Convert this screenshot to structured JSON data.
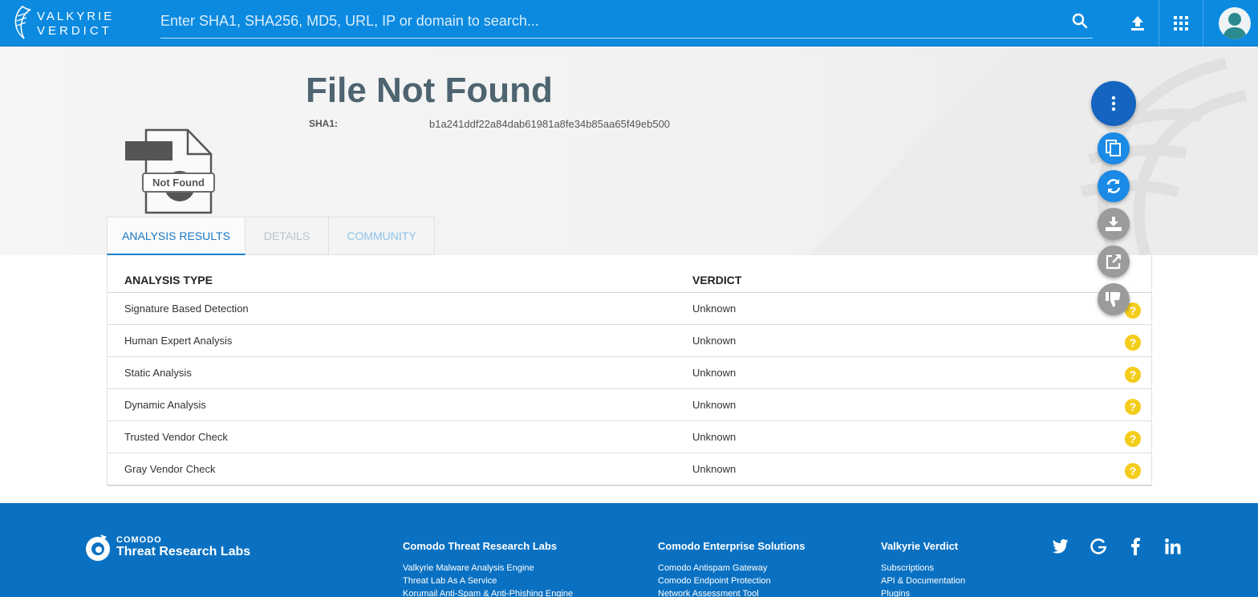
{
  "header": {
    "logo_line1": "VALKYRIE",
    "logo_line2": "VERDICT",
    "search_placeholder": "Enter SHA1, SHA256, MD5, URL, IP or domain to search..."
  },
  "file": {
    "title": "File Not Found",
    "status_badge": "Not Found",
    "sha1_label": "SHA1:",
    "sha1_value": "b1a241ddf22a84dab61981a8fe34b85aa65f49eb500"
  },
  "tabs": [
    {
      "label": "ANALYSIS RESULTS",
      "active": true
    },
    {
      "label": "DETAILS",
      "active": false
    },
    {
      "label": "COMMUNITY",
      "active": false
    }
  ],
  "table": {
    "headers": [
      "ANALYSIS TYPE",
      "VERDICT"
    ],
    "rows": [
      {
        "type": "Signature Based Detection",
        "verdict": "Unknown",
        "icon": "?"
      },
      {
        "type": "Human Expert Analysis",
        "verdict": "Unknown",
        "icon": "?"
      },
      {
        "type": "Static Analysis",
        "verdict": "Unknown",
        "icon": "?"
      },
      {
        "type": "Dynamic Analysis",
        "verdict": "Unknown",
        "icon": "?"
      },
      {
        "type": "Trusted Vendor Check",
        "verdict": "Unknown",
        "icon": "?"
      },
      {
        "type": "Gray Vendor Check",
        "verdict": "Unknown",
        "icon": "?"
      }
    ]
  },
  "fab_icons": [
    "more-vert-icon",
    "copy-icon",
    "refresh-icon",
    "download-icon",
    "external-link-icon",
    "thumbs-down-icon"
  ],
  "footer": {
    "logo_line1": "COMODO",
    "logo_line2": "Threat Research Labs",
    "columns": [
      {
        "title": "Comodo Threat Research Labs",
        "links": [
          "Valkyrie Malware Analysis Engine",
          "Threat Lab As A Service",
          "Korumail Anti-Spam & Anti-Phishing Engine"
        ]
      },
      {
        "title": "Comodo Enterprise Solutions",
        "links": [
          "Comodo Antispam Gateway",
          "Comodo Endpoint Protection",
          "Network Assessment Tool"
        ]
      },
      {
        "title": "Valkyrie Verdict",
        "links": [
          "Subscriptions",
          "API & Documentation",
          "Plugins"
        ]
      }
    ],
    "social_icons": [
      "twitter-icon",
      "google-icon",
      "facebook-icon",
      "linkedin-icon"
    ]
  },
  "colors": {
    "topbar": "#0b8ae0",
    "footer": "#0a71c2",
    "accent": "#1a80d0",
    "unknown_icon": "#f4cc1a",
    "title": "#4e6470"
  }
}
